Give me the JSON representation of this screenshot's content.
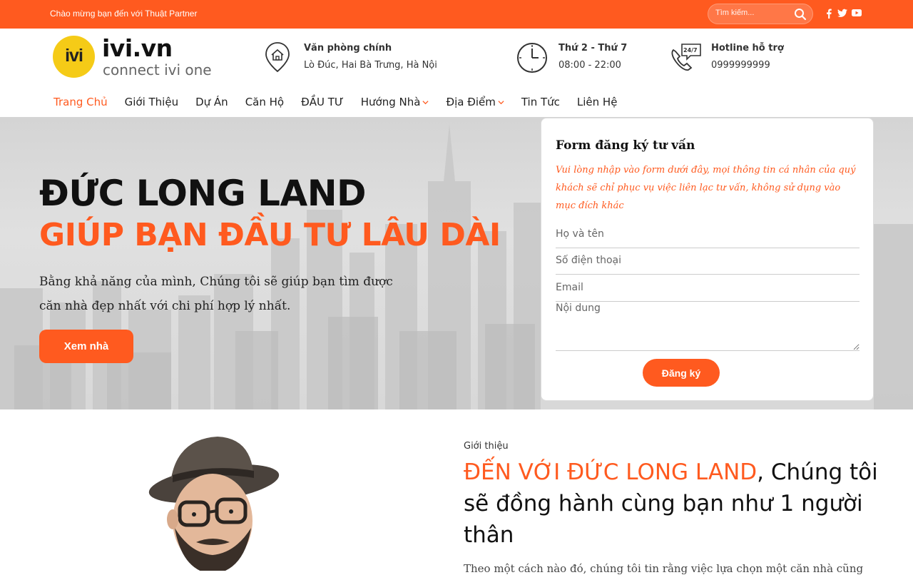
{
  "topbar": {
    "welcome": "Chào mừng bạn đến với Thuật Partner",
    "search_placeholder": "Tìm kiếm..."
  },
  "header": {
    "logo_mark": "ivi",
    "logo_name": "ivi.vn",
    "logo_tagline": "connect ivi one",
    "office": {
      "title": "Văn phòng chính",
      "value": "Lò Đúc, Hai Bà Trưng, Hà Nội"
    },
    "hours": {
      "title": "Thứ 2 - Thứ 7",
      "value": "08:00 - 22:00"
    },
    "hotline": {
      "title": "Hotline hỗ trợ",
      "value": "0999999999",
      "badge": "24/7"
    }
  },
  "nav": {
    "items": [
      {
        "label": "Trang Chủ"
      },
      {
        "label": "Giới Thiệu"
      },
      {
        "label": "Dự Án"
      },
      {
        "label": "Căn Hộ"
      },
      {
        "label": "ĐẦU TƯ"
      },
      {
        "label": "Hướng Nhà"
      },
      {
        "label": "Địa Điểm"
      },
      {
        "label": "Tin Tức"
      },
      {
        "label": "Liên Hệ"
      }
    ]
  },
  "hero": {
    "title_line1": "ĐỨC LONG LAND",
    "title_line2": "GIÚP BẠN ĐẦU TƯ LÂU DÀI",
    "description": "Bằng khả năng của mình, Chúng tôi sẽ giúp bạn tìm được căn nhà đẹp nhất với chi phí hợp lý nhất.",
    "button": "Xem nhà"
  },
  "form": {
    "title": "Form đăng ký tư vấn",
    "note": "Vui lòng nhập vào form dưới đây, mọi thông tin cá nhân của quý khách sẽ chỉ phục vụ việc liên lạc tư vấn, không sử dụng vào mục đích khác",
    "name_placeholder": "Họ và tên",
    "phone_placeholder": "Số điện thoại",
    "email_placeholder": "Email",
    "content_placeholder": "Nội dung",
    "submit": "Đăng ký"
  },
  "about": {
    "label": "Giới thiệu",
    "heading_highlight": "ĐẾN VỚI ĐỨC LONG LAND",
    "heading_rest": ", Chúng tôi sẽ đồng hành cùng bạn như 1 người thân",
    "text": "Theo một cách nào đó, chúng tôi tin rằng việc lựa chọn một căn nhà cũng"
  },
  "colors": {
    "accent": "#ff5a1f",
    "logo_yellow": "#f5cb17"
  }
}
